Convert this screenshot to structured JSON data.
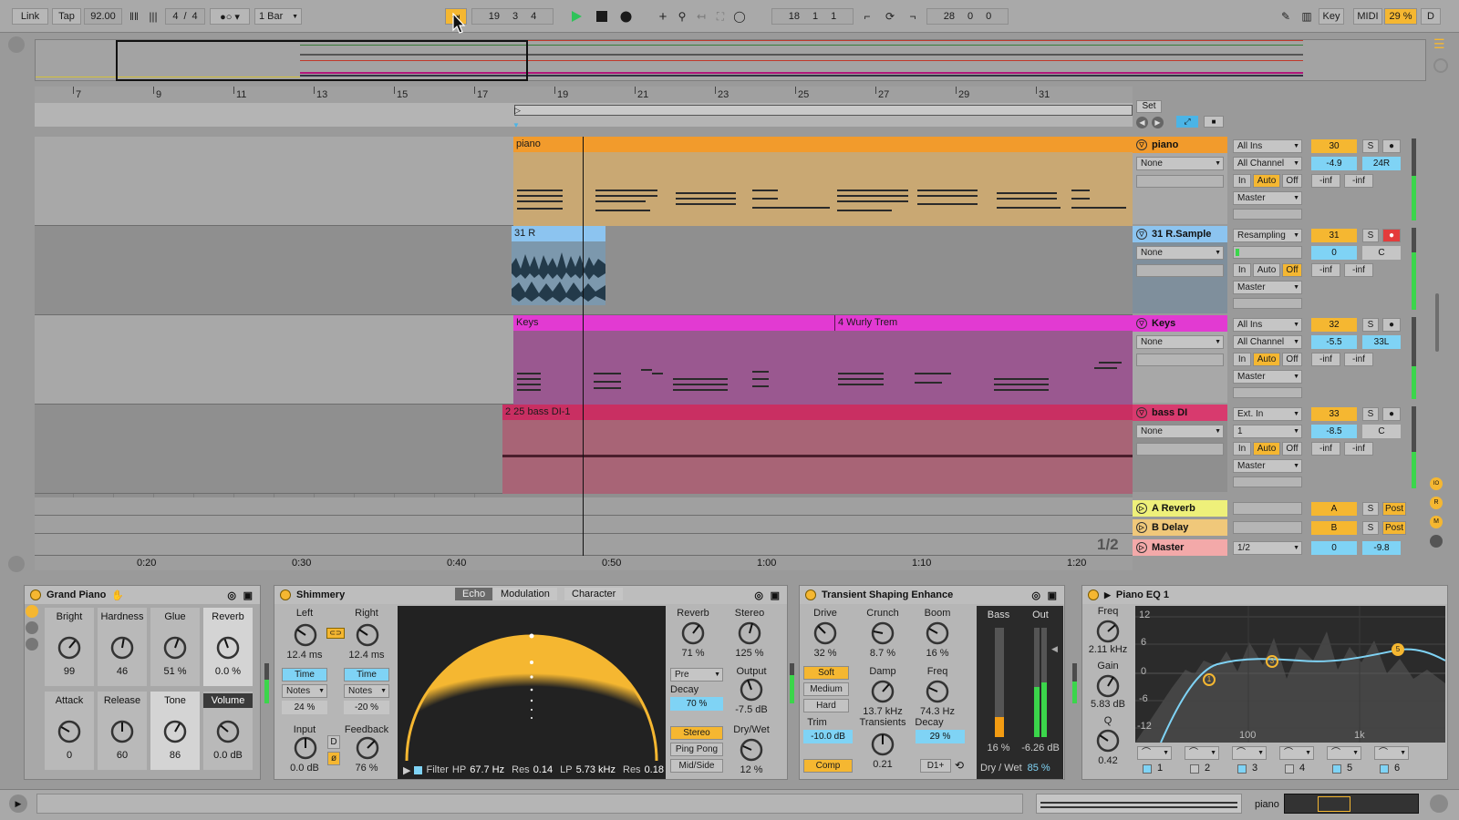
{
  "toolbar": {
    "link": "Link",
    "tap": "Tap",
    "tempo": "92.00",
    "sig_num": "4",
    "sig_slash": "/",
    "sig_den": "4",
    "quant": "1 Bar",
    "arr_position": [
      "19",
      "3",
      "4"
    ],
    "loop_start": [
      "18",
      "1",
      "1"
    ],
    "loop_length": [
      "28",
      "0",
      "0"
    ],
    "key": "Key",
    "midi": "MIDI",
    "cpu": "29 %",
    "d": "D"
  },
  "ruler_bars": [
    "7",
    "9",
    "11",
    "13",
    "15",
    "17",
    "19",
    "21",
    "23",
    "25",
    "27",
    "29",
    "31"
  ],
  "time_ruler": [
    "0:20",
    "0:30",
    "0:40",
    "0:50",
    "1:00",
    "1:10",
    "1:20"
  ],
  "set_label": "Set",
  "page_indicator": "1/2",
  "clips": {
    "piano": "piano",
    "sample": "31 R",
    "keys": "Keys",
    "wurly": "4 Wurly Trem",
    "bass": "2  25 bass DI-1"
  },
  "tracks": [
    {
      "name": "piano",
      "color": "#f29b2c",
      "input": "All Ins",
      "channel": "All Channel",
      "none": "None",
      "out": "Master",
      "num": "30",
      "vol": "-4.9",
      "pan": "24R",
      "in": "In",
      "auto": "Auto",
      "off": "Off",
      "inf1": "-inf",
      "inf2": "-inf",
      "s": "S"
    },
    {
      "name": "31 R.Sample",
      "color": "#8cc4f0",
      "input": "Resampling",
      "channel": "",
      "none": "None",
      "out": "Master",
      "num": "31",
      "vol": "0",
      "pan": "C",
      "in": "In",
      "auto": "Auto",
      "off": "Off",
      "inf1": "-inf",
      "inf2": "-inf",
      "s": "S"
    },
    {
      "name": "Keys",
      "color": "#e23ad2",
      "input": "All Ins",
      "channel": "All Channel",
      "none": "None",
      "out": "Master",
      "num": "32",
      "vol": "-5.5",
      "pan": "33L",
      "in": "In",
      "auto": "Auto",
      "off": "Off",
      "inf1": "-inf",
      "inf2": "-inf",
      "s": "S"
    },
    {
      "name": "bass DI",
      "color": "#d83a6e",
      "input": "Ext. In",
      "channel": "1",
      "none": "None",
      "out": "Master",
      "num": "33",
      "vol": "-8.5",
      "pan": "C",
      "in": "In",
      "auto": "Auto",
      "off": "Off",
      "inf1": "-inf",
      "inf2": "-inf",
      "s": "S"
    }
  ],
  "returns": [
    {
      "name": "A Reverb",
      "color": "#eef07a",
      "letter": "A",
      "s": "S",
      "post": "Post"
    },
    {
      "name": "B Delay",
      "color": "#f0c87a",
      "letter": "B",
      "s": "S",
      "post": "Post"
    }
  ],
  "master": {
    "name": "Master",
    "color": "#f3a9a9",
    "route": "1/2",
    "num": "0",
    "vol": "-9.8"
  },
  "devices": {
    "grand_piano": {
      "title": "Grand Piano",
      "knobs": [
        {
          "label": "Bright",
          "value": "99"
        },
        {
          "label": "Hardness",
          "value": "46"
        },
        {
          "label": "Glue",
          "value": "51 %"
        },
        {
          "label": "Reverb",
          "value": "0.0 %"
        },
        {
          "label": "Attack",
          "value": "0"
        },
        {
          "label": "Release",
          "value": "60"
        },
        {
          "label": "Tone",
          "value": "86"
        },
        {
          "label": "Volume",
          "value": "0.0 dB"
        }
      ]
    },
    "shimmery": {
      "title": "Shimmery",
      "tabs": [
        "Echo",
        "Modulation",
        "Character"
      ],
      "left_label": "Left",
      "left_val": "12.4 ms",
      "right_label": "Right",
      "right_val": "12.4 ms",
      "time": "Time",
      "notes": "Notes",
      "left_pct": "24 %",
      "right_pct": "-20 %",
      "input_label": "Input",
      "input_val": "0.0 dB",
      "feedback_label": "Feedback",
      "feedback_val": "76 %",
      "d_btn": "D",
      "reverb_label": "Reverb",
      "reverb_val": "71 %",
      "stereo_label": "Stereo",
      "stereo_val": "125 %",
      "pre": "Pre",
      "output_label": "Output",
      "output_val": "-7.5 dB",
      "decay_label": "Decay",
      "decay_val": "70 %",
      "drywet_label": "Dry/Wet",
      "drywet_val": "12 %",
      "mode_stereo": "Stereo",
      "mode_ping": "Ping Pong",
      "mode_mid": "Mid/Side",
      "filter": "Filter",
      "hp_label": "HP",
      "hp_val": "67.7 Hz",
      "res1_label": "Res",
      "res1_val": "0.14",
      "lp_label": "LP",
      "lp_val": "5.73 kHz",
      "res2_label": "Res",
      "res2_val": "0.18"
    },
    "transient": {
      "title": "Transient Shaping Enhance",
      "drive_label": "Drive",
      "drive_val": "32 %",
      "crunch_label": "Crunch",
      "crunch_val": "8.7 %",
      "boom_label": "Boom",
      "boom_val": "16 %",
      "soft": "Soft",
      "medium": "Medium",
      "hard": "Hard",
      "damp_label": "Damp",
      "damp_val": "13.7 kHz",
      "freq_label": "Freq",
      "freq_val": "74.3 Hz",
      "trim_label": "Trim",
      "trim_val": "-10.0 dB",
      "transients_label": "Transients",
      "transients_val": "0.21",
      "decay_label": "Decay",
      "decay_val": "29 %",
      "comp": "Comp",
      "d1": "D1+",
      "bass_label": "Bass",
      "out_label": "Out",
      "bass_val": "16 %",
      "out_val": "-6.26 dB",
      "drywet_label": "Dry / Wet",
      "drywet_val": "85 %"
    },
    "eq": {
      "title": "Piano EQ 1",
      "freq_label": "Freq",
      "freq_val": "2.11 kHz",
      "gain_label": "Gain",
      "gain_val": "5.83 dB",
      "q_label": "Q",
      "q_val": "0.42",
      "y_ticks": [
        "12",
        "6",
        "0",
        "-6",
        "-12"
      ],
      "x_ticks": [
        "100",
        "1k"
      ],
      "bands": [
        "1",
        "2",
        "3",
        "4",
        "5",
        "6"
      ],
      "points": [
        "1",
        "3",
        "5"
      ]
    }
  },
  "status": {
    "track": "piano"
  }
}
